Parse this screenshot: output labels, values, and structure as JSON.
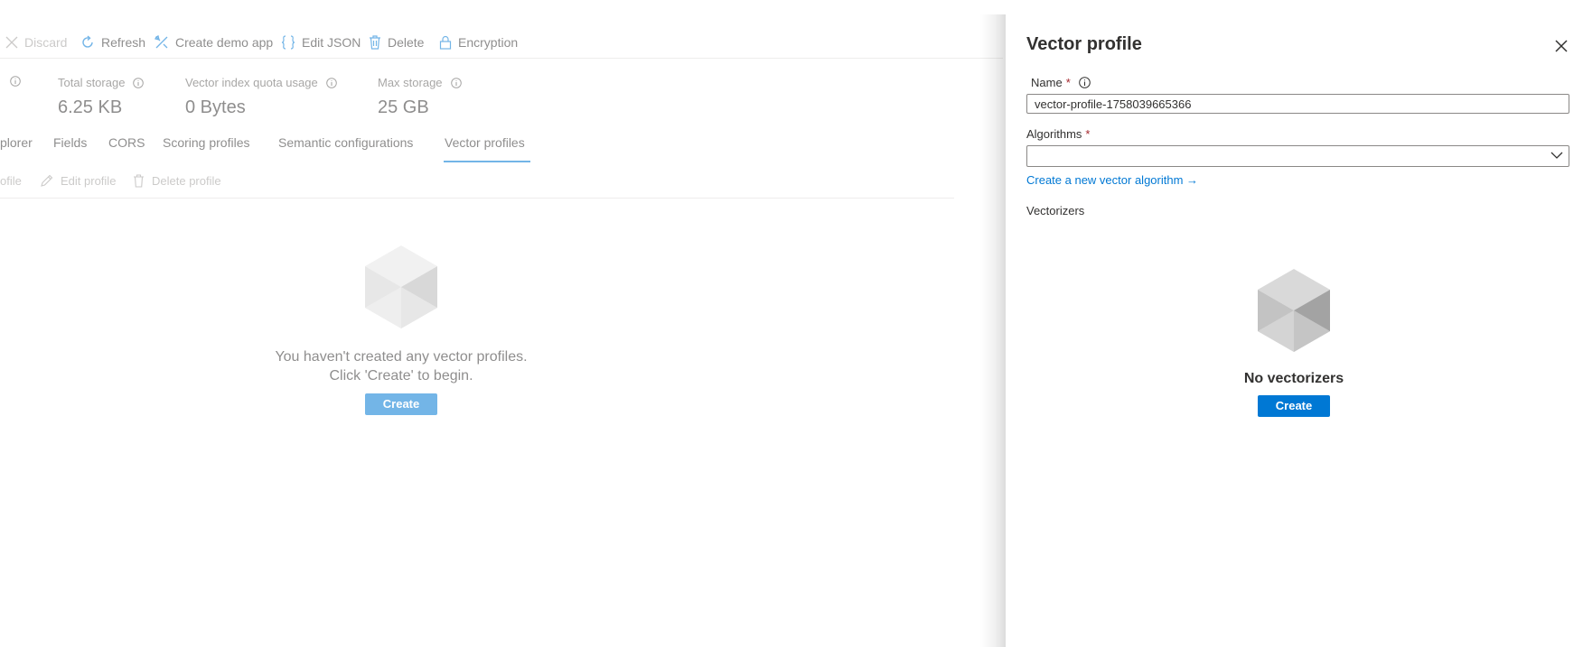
{
  "toolbar": {
    "items": [
      {
        "label": "Discard",
        "icon": "close-icon",
        "disabled": true
      },
      {
        "label": "Refresh",
        "icon": "refresh-icon"
      },
      {
        "label": "Create demo app",
        "icon": "tools-icon"
      },
      {
        "label": "Edit JSON",
        "icon": "braces-icon"
      },
      {
        "label": "Delete",
        "icon": "trash-icon"
      },
      {
        "label": "Encryption",
        "icon": "lock-icon"
      }
    ]
  },
  "metrics": [
    {
      "label": "Total storage",
      "value": "6.25 KB"
    },
    {
      "label": "Vector index quota usage",
      "value": "0 Bytes"
    },
    {
      "label": "Max storage",
      "value": "25 GB"
    }
  ],
  "tabs": [
    {
      "label": "plorer"
    },
    {
      "label": "Fields"
    },
    {
      "label": "CORS"
    },
    {
      "label": "Scoring profiles"
    },
    {
      "label": "Semantic configurations"
    },
    {
      "label": "Vector profiles",
      "active": true
    }
  ],
  "subtoolbar": {
    "items": [
      {
        "label": "ofile"
      },
      {
        "label": "Edit profile",
        "icon": "pencil-icon"
      },
      {
        "label": "Delete profile",
        "icon": "trash-icon"
      }
    ]
  },
  "main_empty": {
    "line1": "You haven't created any vector profiles.",
    "line2": "Click 'Create' to begin.",
    "button": "Create"
  },
  "panel": {
    "title": "Vector profile",
    "name_label": "Name",
    "name_value": "vector-profile-1758039665366",
    "required_mark": "*",
    "algorithms_label": "Algorithms",
    "algorithms_value": "",
    "create_algorithm_link": "Create a new vector algorithm →",
    "vectorizers_label": "Vectorizers",
    "empty_title": "No vectorizers",
    "create_button": "Create"
  },
  "colors": {
    "accent": "#0078d4",
    "required": "#a4262c",
    "text": "#323130",
    "muted": "#605e5c"
  }
}
